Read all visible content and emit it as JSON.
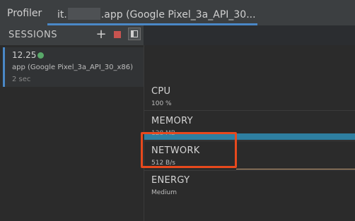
{
  "tabs": {
    "profiler_label": "Profiler",
    "app_prefix": "it.",
    "app_suffix": ".app (Google Pixel_3a_API_30..."
  },
  "sessions": {
    "title": "SESSIONS",
    "add_icon": "plus-icon",
    "stop_icon": "stop-icon",
    "dock_icon": "toggle-panel-icon",
    "items": [
      {
        "time": "12.25",
        "status": "live",
        "status_color": "#59a869",
        "name": "app (Google Pixel_3a_API_30_x86)",
        "duration": "2 sec"
      }
    ]
  },
  "monitors": [
    {
      "title": "CPU",
      "value": "100 %"
    },
    {
      "title": "MEMORY",
      "value": "128 MB"
    },
    {
      "title": "NETWORK",
      "value": "512 B/s"
    },
    {
      "title": "ENERGY",
      "value": "Medium"
    }
  ],
  "colors": {
    "accent": "#4a88c7",
    "memory_series": "#2e7fa1",
    "highlight": "#e8491d",
    "stop": "#c75450"
  }
}
